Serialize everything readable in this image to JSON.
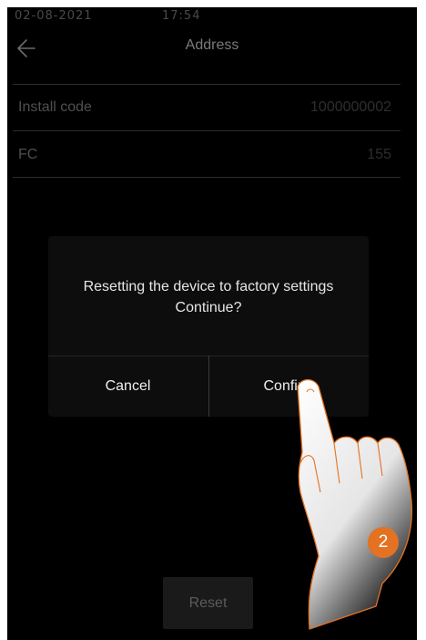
{
  "status_bar": {
    "date": "02-08-2021",
    "time": "17:54"
  },
  "header": {
    "title": "Address",
    "back_icon": "arrow-left-icon"
  },
  "fields": [
    {
      "label": "Install code",
      "value": "1000000002"
    },
    {
      "label": "FC",
      "value": "155"
    }
  ],
  "dialog": {
    "message_line1": "Resetting the device to factory settings",
    "message_line2": "Continue?",
    "cancel_label": "Cancel",
    "confirm_label": "Confirm"
  },
  "reset_button": {
    "label": "Reset"
  },
  "annotation": {
    "step_number": "2",
    "badge_color": "#e37222",
    "hand_outline_color": "#e37222"
  }
}
